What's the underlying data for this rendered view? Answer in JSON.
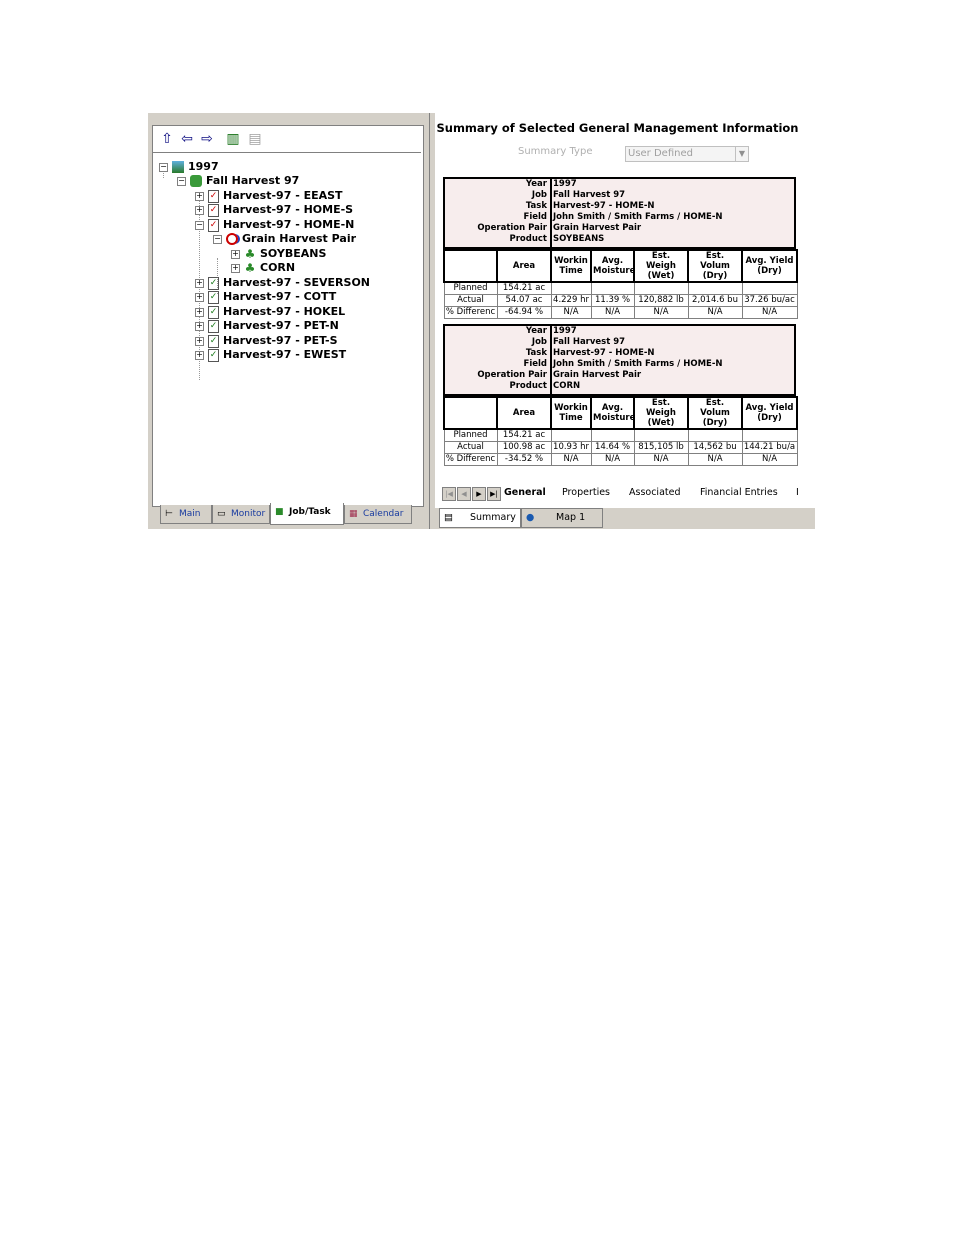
{
  "toolbar": {
    "buttons": [
      "up-arrow-icon",
      "back-arrow-icon",
      "forward-arrow-icon",
      "split-view-icon",
      "properties-icon"
    ]
  },
  "tree": {
    "year": "1997",
    "job": "Fall Harvest 97",
    "tasks": [
      "Harvest-97 - EEAST",
      "Harvest-97 - HOME-S",
      "Harvest-97 - HOME-N",
      "Harvest-97 - SEVERSON",
      "Harvest-97 - COTT",
      "Harvest-97 - HOKEL",
      "Harvest-97 - PET-N",
      "Harvest-97 - PET-S",
      "Harvest-97 - EWEST"
    ],
    "operation_pair": "Grain Harvest Pair",
    "products": [
      "SOYBEANS",
      "CORN"
    ]
  },
  "left_tabs": [
    "Main",
    "Monitor",
    "Job/Task",
    "Calendar"
  ],
  "left_active_tab": "Job/Task",
  "summary": {
    "title": "Summary of Selected General Management Information",
    "type_label": "Summary Type",
    "type_value": "User Defined",
    "header_labels": [
      "Year",
      "Job",
      "Task",
      "Field",
      "Operation Pair",
      "Product"
    ],
    "columns": [
      "",
      "Area",
      "Workin Time",
      "Avg. Moisture",
      "Est. Weigh (Wet)",
      "Est. Volum (Dry)",
      "Avg. Yield (Dry)"
    ],
    "cards": [
      {
        "year": "1997",
        "job": "Fall Harvest 97",
        "task": "Harvest-97 - HOME-N",
        "field": "John Smith / Smith Farms / HOME-N",
        "operation_pair": "Grain Harvest Pair",
        "product": "SOYBEANS",
        "rows": [
          [
            "Planned",
            "154.21 ac",
            "",
            "",
            "",
            "",
            ""
          ],
          [
            "Actual",
            "54.07 ac",
            "4.229 hr",
            "11.39 %",
            "120,882 lb",
            "2,014.6 bu",
            "37.26 bu/ac"
          ],
          [
            "% Differenc",
            "-64.94 %",
            "N/A",
            "N/A",
            "N/A",
            "N/A",
            "N/A"
          ]
        ]
      },
      {
        "year": "1997",
        "job": "Fall Harvest 97",
        "task": "Harvest-97 - HOME-N",
        "field": "John Smith / Smith Farms / HOME-N",
        "operation_pair": "Grain Harvest Pair",
        "product": "CORN",
        "rows": [
          [
            "Planned",
            "154.21 ac",
            "",
            "",
            "",
            "",
            ""
          ],
          [
            "Actual",
            "100.98 ac",
            "10.93 hr",
            "14.64 %",
            "815,105 lb",
            "14,562 bu",
            "144.21 bu/a"
          ],
          [
            "% Differenc",
            "-34.52 %",
            "N/A",
            "N/A",
            "N/A",
            "N/A",
            "N/A"
          ]
        ]
      }
    ]
  },
  "bottom_tabs": [
    "General",
    "Properties",
    "Associated",
    "Financial Entries",
    "I"
  ],
  "bottom_active_tab": "General",
  "view_tabs": [
    "Summary",
    "Map 1"
  ],
  "view_active_tab": "Summary"
}
